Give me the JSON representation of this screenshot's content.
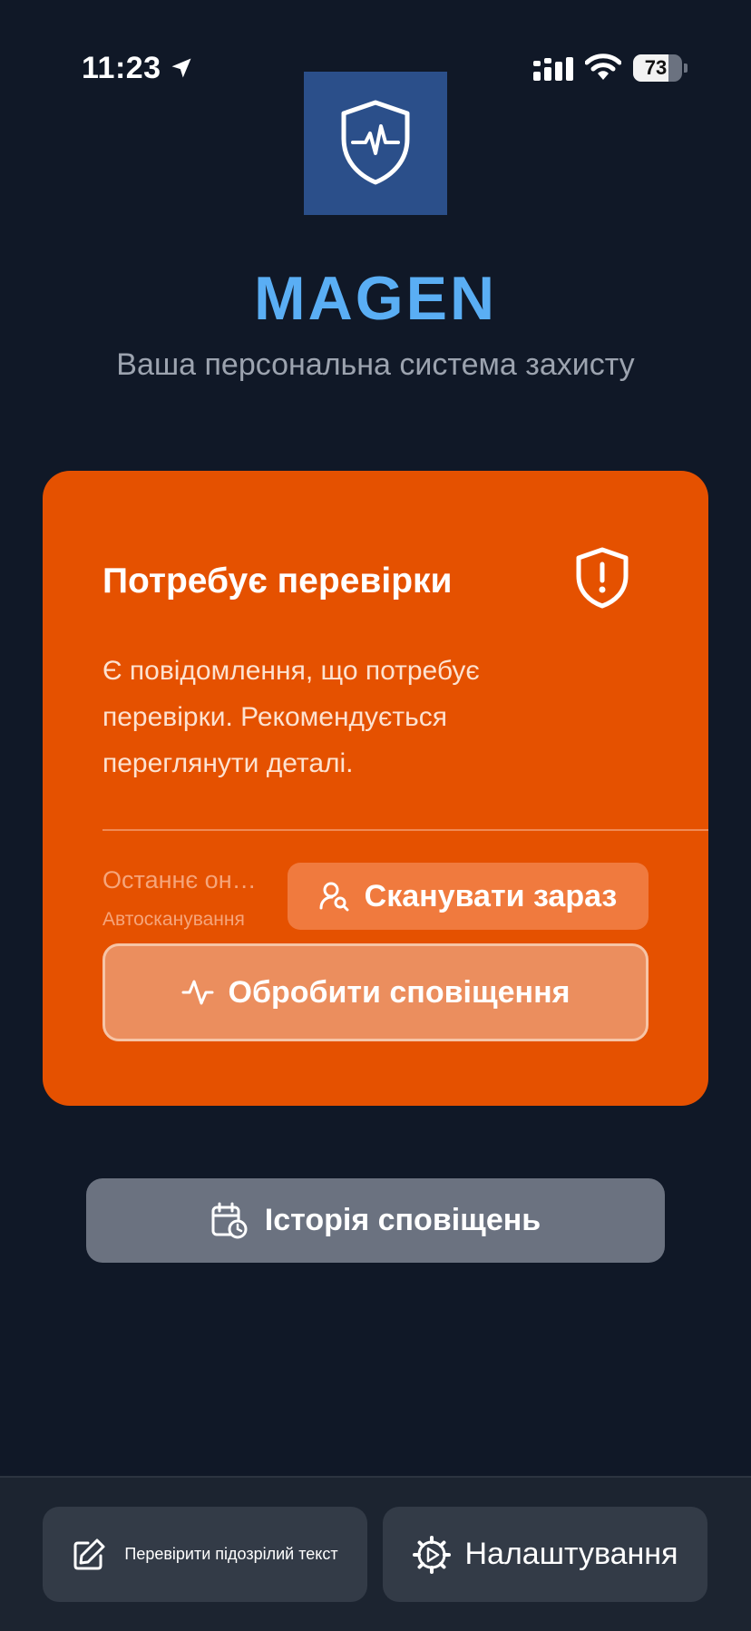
{
  "status_bar": {
    "time": "11:23",
    "battery_level": 73,
    "battery_text": "73"
  },
  "header": {
    "logo_icon": "shield-pulse-icon",
    "app_title": "MAGEN",
    "subtitle": "Ваша персональна система захисту"
  },
  "status_card": {
    "title": "Потребує перевірки",
    "description": "Є повідомлення, що потребує перевірки. Рекомендується переглянути деталі.",
    "last_scan_label": "Останнє оновлення",
    "auto_scan_label": "Автосканування",
    "scan_button_label": "Сканувати зараз",
    "process_button_label": "Обробити сповіщення",
    "icon": "shield-alert-icon",
    "color": "#e55100"
  },
  "history_button_label": "Історія сповіщень",
  "bottom_bar": {
    "check_text_label": "Перевірити підозрілий текст",
    "settings_label": "Налаштування"
  },
  "colors": {
    "background": "#101827",
    "accent": "#5aaef4",
    "warning": "#e55100"
  }
}
